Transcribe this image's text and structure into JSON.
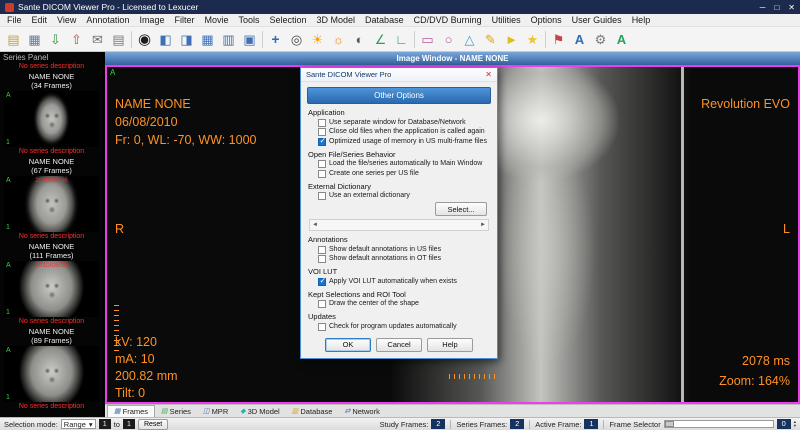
{
  "window": {
    "title": "Sante DICOM Viewer Pro - Licensed to Lexucer",
    "controls": {
      "minimize": "─",
      "maximize": "□",
      "close": "✕"
    }
  },
  "menubar": {
    "items": [
      "File",
      "Edit",
      "View",
      "Annotation",
      "Image",
      "Filter",
      "Movie",
      "Tools",
      "Selection",
      "3D Model",
      "Database",
      "CD/DVD Burning",
      "Utilities",
      "Options",
      "User Guides",
      "Help"
    ]
  },
  "toolbar": {
    "icons": [
      {
        "name": "open-folder-icon",
        "glyph": "▤",
        "style": "color:#c59b45"
      },
      {
        "name": "save-icon",
        "glyph": "▦",
        "style": "color:#5b7aa6"
      },
      {
        "name": "import-icon",
        "glyph": "⇩",
        "style": "color:#3f8f3f"
      },
      {
        "name": "export-icon",
        "glyph": "⇧",
        "style": "color:#b05050"
      },
      {
        "name": "mail-icon",
        "glyph": "✉",
        "style": "color:#6f6f6f"
      },
      {
        "name": "print-icon",
        "glyph": "▤",
        "style": "color:#7a7a7a"
      },
      {
        "name": "eye-icon",
        "glyph": "◉",
        "style": "color:#1b1b1b;font-size:15px"
      },
      {
        "name": "layout-left-icon",
        "glyph": "◧",
        "style": "color:#3f6fb5"
      },
      {
        "name": "layout-right-icon",
        "glyph": "◨",
        "style": "color:#3f6fb5"
      },
      {
        "name": "layout-grid-icon",
        "glyph": "▦",
        "style": "color:#3f6fb5"
      },
      {
        "name": "tile-windows-icon",
        "glyph": "▥",
        "style": "color:#3f6fb5"
      },
      {
        "name": "fullscreen-icon",
        "glyph": "▣",
        "style": "color:#3f6fb5"
      },
      {
        "name": "pan-icon",
        "glyph": "+",
        "style": "color:#2e6db4;font-weight:bold;font-size:14px"
      },
      {
        "name": "zoom-icon",
        "glyph": "◎",
        "style": "color:#444444"
      },
      {
        "name": "sun-icon",
        "glyph": "☀",
        "style": "color:#f6a01a"
      },
      {
        "name": "brightness-icon",
        "glyph": "☼",
        "style": "color:#f08a1a"
      },
      {
        "name": "invert-icon",
        "glyph": "◐",
        "style": "color:#555555"
      },
      {
        "name": "ruler-icon",
        "glyph": "∠",
        "style": "color:#2aa05a"
      },
      {
        "name": "angle-icon",
        "glyph": "∟",
        "style": "color:#2aa05a"
      },
      {
        "name": "rect-tool-icon",
        "glyph": "▭",
        "style": "color:#b5599b"
      },
      {
        "name": "ellipse-tool-icon",
        "glyph": "○",
        "style": "color:#b5599b"
      },
      {
        "name": "polygon-tool-icon",
        "glyph": "△",
        "style": "color:#3aa0d0"
      },
      {
        "name": "pencil-icon",
        "glyph": "✎",
        "style": "color:#d8a520"
      },
      {
        "name": "arrow-tool-icon",
        "glyph": "►",
        "style": "color:#d8c020"
      },
      {
        "name": "star-icon",
        "glyph": "★",
        "style": "color:#e8c63a"
      },
      {
        "name": "flag-icon",
        "glyph": "⚑",
        "style": "color:#d04040"
      },
      {
        "name": "text-tool-icon",
        "glyph": "A",
        "style": "color:#2e6db4;font-weight:bold"
      },
      {
        "name": "gear-icon",
        "glyph": "⚙",
        "style": "color:#7a7a7a"
      },
      {
        "name": "annotation-text-icon",
        "glyph": "A",
        "style": "color:#2aa05a;font-weight:bold"
      }
    ]
  },
  "series_panel": {
    "title": "Series Panel",
    "partial_desc": "No series description",
    "items": [
      {
        "name": "NAME NONE",
        "frames": "(34 Frames)",
        "desc": "No series description",
        "marker": "A",
        "index": "1",
        "date": ""
      },
      {
        "name": "NAME NONE",
        "frames": "(67 Frames)",
        "desc": "No series description",
        "marker": "A",
        "index": "1",
        "date": "2010/08/06"
      },
      {
        "name": "NAME NONE",
        "frames": "(111 Frames)",
        "desc": "No series description",
        "marker": "A",
        "index": "1",
        "date": "2010/08/06"
      },
      {
        "name": "NAME NONE",
        "frames": "(89 Frames)",
        "desc": "No series description",
        "marker": "A",
        "index": "1",
        "date": ""
      }
    ]
  },
  "image_window": {
    "title": "Image Window - NAME NONE",
    "annotation_marker": "A",
    "overlay": {
      "patient_name": "NAME NONE",
      "study_date": "06/08/2010",
      "frame_info": "Fr: 0, WL: -70, WW: 1000",
      "device": "Revolution EVO",
      "orientation_left": "R",
      "orientation_right": "L",
      "kv": "kV: 120",
      "ma": "mA: 10",
      "distance": "200.82 mm",
      "tilt": "Tilt: 0",
      "exposure": "2078 ms",
      "zoom": "Zoom: 164%"
    }
  },
  "tabs": {
    "items": [
      {
        "label": "Frames",
        "glyph": "▦",
        "style": "color:#4a7ab5"
      },
      {
        "label": "Series",
        "glyph": "▤",
        "style": "color:#3fae49"
      },
      {
        "label": "MPR",
        "glyph": "◫",
        "style": "color:#4a7ab5"
      },
      {
        "label": "3D Model",
        "glyph": "◆",
        "style": "color:#2ab0b0"
      },
      {
        "label": "Database",
        "glyph": "▥",
        "style": "color:#d9a520"
      },
      {
        "label": "Network",
        "glyph": "⇄",
        "style": "color:#4a7ab5"
      }
    ]
  },
  "dialog": {
    "title": "Sante DICOM Viewer Pro",
    "close": "✕",
    "header": "Other Options",
    "sections": [
      {
        "header": "Application",
        "items": [
          {
            "label": "Use separate window for Database/Network",
            "checked": false
          },
          {
            "label": "Close old files when the application is called again",
            "checked": false
          },
          {
            "label": "Optimized usage of memory in US multi-frame files",
            "checked": true
          }
        ]
      },
      {
        "header": "Open File/Series Behavior",
        "items": [
          {
            "label": "Load the file/series automatically to Main Window",
            "checked": false
          },
          {
            "label": "Create one series per US file",
            "checked": false
          }
        ]
      },
      {
        "header": "External Dictionary",
        "items": [
          {
            "label": "Use an external dictionary",
            "checked": false
          }
        ]
      },
      {
        "header": "Annotations",
        "items": [
          {
            "label": "Show default annotations in US files",
            "checked": false
          },
          {
            "label": "Show default annotations in OT files",
            "checked": false
          }
        ]
      },
      {
        "header": "VOI LUT",
        "items": [
          {
            "label": "Apply VOI LUT automatically when exists",
            "checked": true
          }
        ]
      },
      {
        "header": "Kept Selections and ROI Tool",
        "items": [
          {
            "label": "Draw the center of the shape",
            "checked": false
          }
        ]
      },
      {
        "header": "Updates",
        "items": [
          {
            "label": "Check for program updates automatically",
            "checked": false
          }
        ]
      }
    ],
    "select_button": "Select...",
    "scroll_left": "◄",
    "scroll_right": "►",
    "buttons": {
      "ok": "OK",
      "cancel": "Cancel",
      "help": "Help"
    }
  },
  "statusbar": {
    "selection_mode_label": "Selection mode:",
    "selection_mode_value": "Range",
    "caret": "▾",
    "range_start": "1",
    "to_label": "to",
    "range_end": "1",
    "reset_label": "Reset",
    "study_frames_label": "Study Frames:",
    "study_frames_value": "2",
    "series_frames_label": "Series Frames:",
    "series_frames_value": "2",
    "active_frame_label": "Active Frame:",
    "active_frame_value": "1",
    "frame_selector_label": "Frame Selector",
    "frame_selector_value": "0",
    "spin_up": "▴",
    "spin_down": "▾"
  }
}
